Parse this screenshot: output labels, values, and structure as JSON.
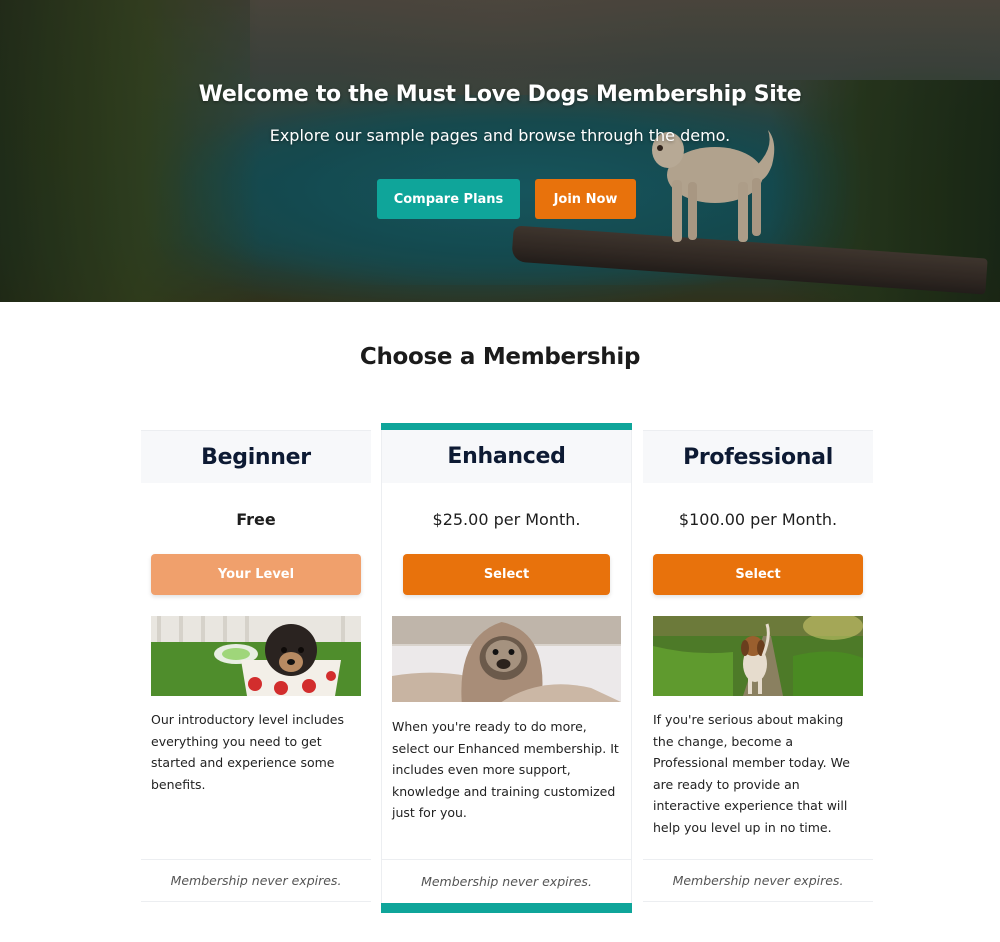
{
  "hero": {
    "title": "Welcome to the Must Love Dogs Membership Site",
    "subtitle": "Explore our sample pages and browse through the demo.",
    "buttons": [
      {
        "label": "Compare Plans",
        "color": "#0fa59a"
      },
      {
        "label": "Join Now",
        "color": "#e8720c"
      }
    ],
    "background_image": "dog-on-log-lake-landscape"
  },
  "membership": {
    "title": "Choose a Membership",
    "accent_color": "#0fa59a",
    "plans": [
      {
        "name": "Beginner",
        "price": "Free",
        "button_label": "Your Level",
        "image": "puppy-in-polka-dot-cup",
        "description": "Our introductory level includes everything you need to get started and experience some benefits.",
        "footer": "Membership never expires."
      },
      {
        "name": "Enhanced",
        "price": "$25.00 per Month.",
        "button_label": "Select",
        "image": "pug-in-blanket",
        "description": "When you're ready to do more, select our Enhanced membership. It includes even more support, knowledge and training customized just for you.",
        "footer": "Membership never expires.",
        "featured": true
      },
      {
        "name": "Professional",
        "price": "$100.00 per Month.",
        "button_label": "Select",
        "image": "beagle-running-on-grass",
        "description": "If you're serious about making the change, become a Professional member today. We are ready to provide an interactive experience that will help you level up in no time.",
        "footer": "Membership never expires."
      }
    ]
  }
}
